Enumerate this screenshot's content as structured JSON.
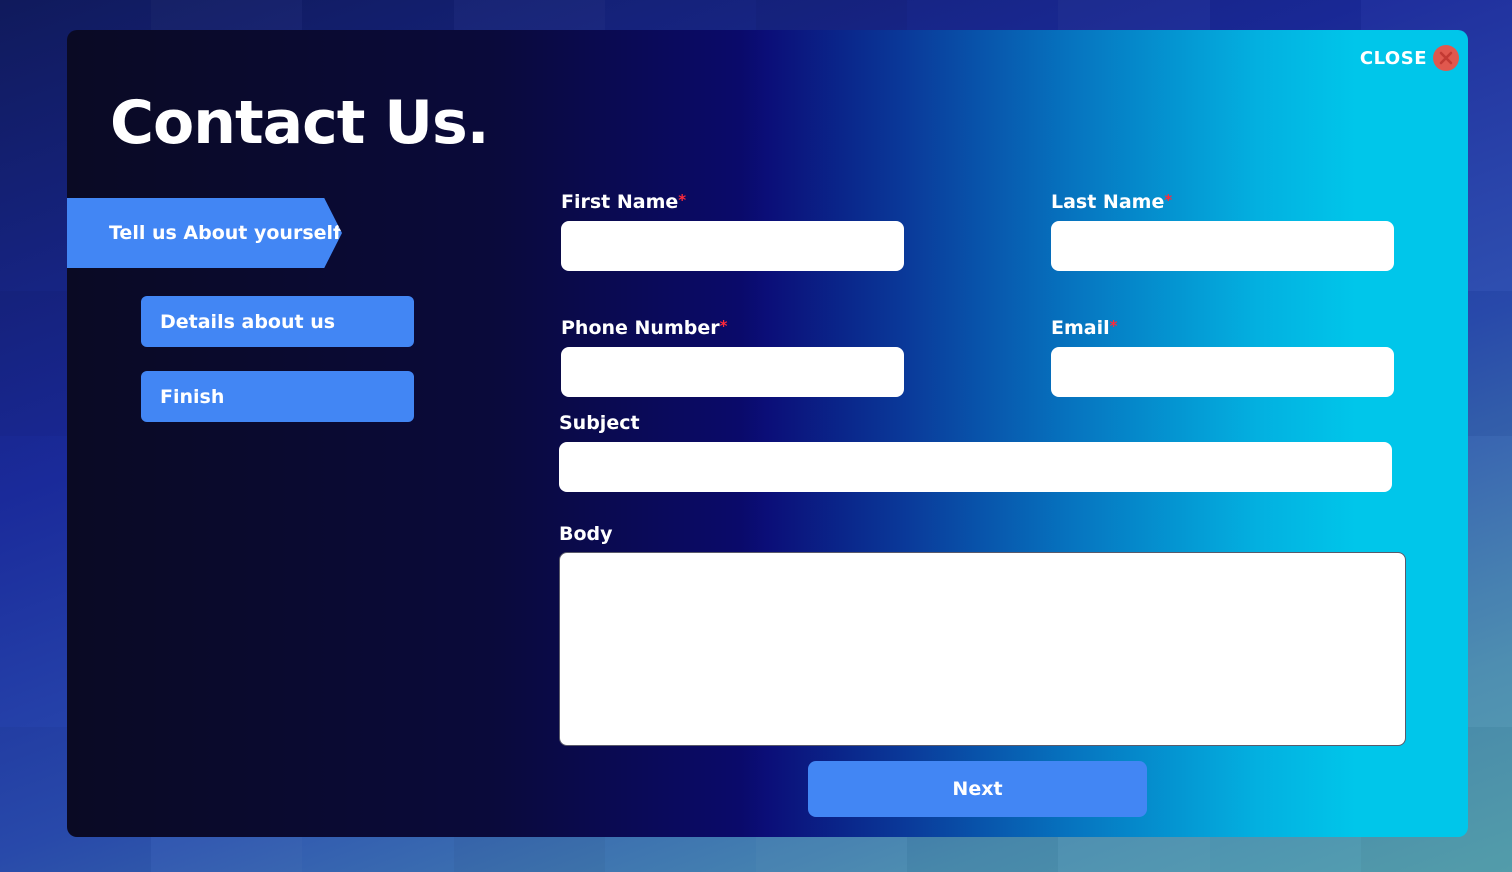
{
  "dialog": {
    "title": "Contact Us.",
    "close_label": "CLOSE"
  },
  "steps": [
    {
      "label": "Tell us About yourself",
      "active": true
    },
    {
      "label": "Details about us",
      "active": false
    },
    {
      "label": "Finish",
      "active": false
    }
  ],
  "form": {
    "first_name": {
      "label": "First Name",
      "required_mark": "*",
      "value": ""
    },
    "last_name": {
      "label": "Last Name",
      "required_mark": "*",
      "value": ""
    },
    "phone": {
      "label": "Phone Number",
      "required_mark": "*",
      "value": ""
    },
    "email": {
      "label": "Email",
      "required_mark": "*",
      "value": ""
    },
    "subject": {
      "label": "Subject",
      "value": ""
    },
    "body": {
      "label": "Body",
      "value": ""
    }
  },
  "actions": {
    "next_label": "Next"
  },
  "colors": {
    "accent": "#4286f4",
    "required": "#ff2a3a",
    "close_icon": "#e0584e",
    "gradient_end": "#00c6ea"
  },
  "icons": {
    "close": "close-circle-icon"
  }
}
